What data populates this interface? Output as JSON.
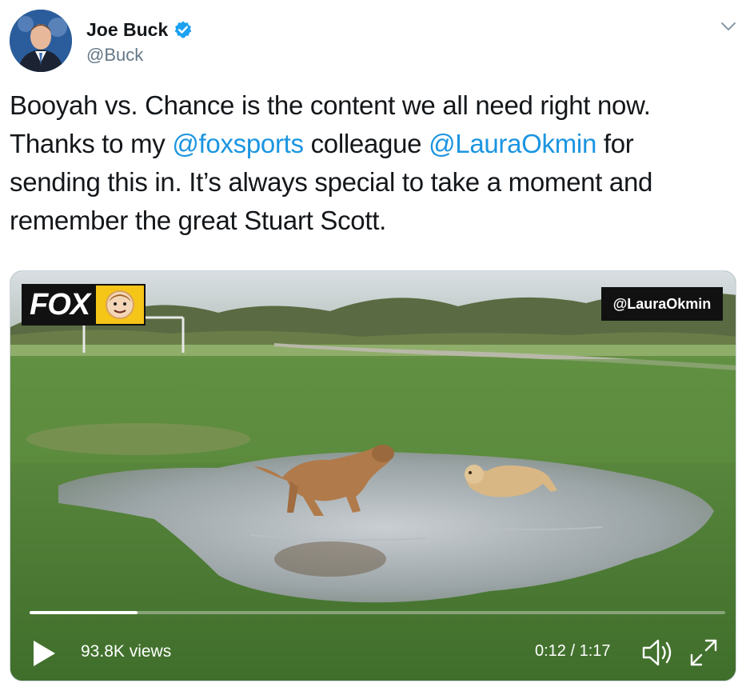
{
  "tweet": {
    "author": {
      "display_name": "Joe Buck",
      "handle": "@Buck",
      "verified": true
    },
    "text_parts": {
      "p1": "Booyah vs. Chance is the content we all need right now. Thanks to my ",
      "mention1": "@foxsports",
      "p2": " colleague ",
      "mention2": "@LauraOkmin",
      "p3": " for sending this in. It’s always special to take a moment and remember the great Stuart Scott."
    }
  },
  "media": {
    "logo_text": "FOX",
    "watermark": "@LauraOkmin",
    "views": "93.8K views",
    "time": "0:12 / 1:17",
    "progress": 0.155
  },
  "colors": {
    "link": "#1b95e0",
    "verified": "#1da1f2",
    "handle": "#657786"
  },
  "icons": [
    "verified-badge-icon",
    "chevron-down-icon",
    "play-icon",
    "volume-icon",
    "fullscreen-icon"
  ]
}
